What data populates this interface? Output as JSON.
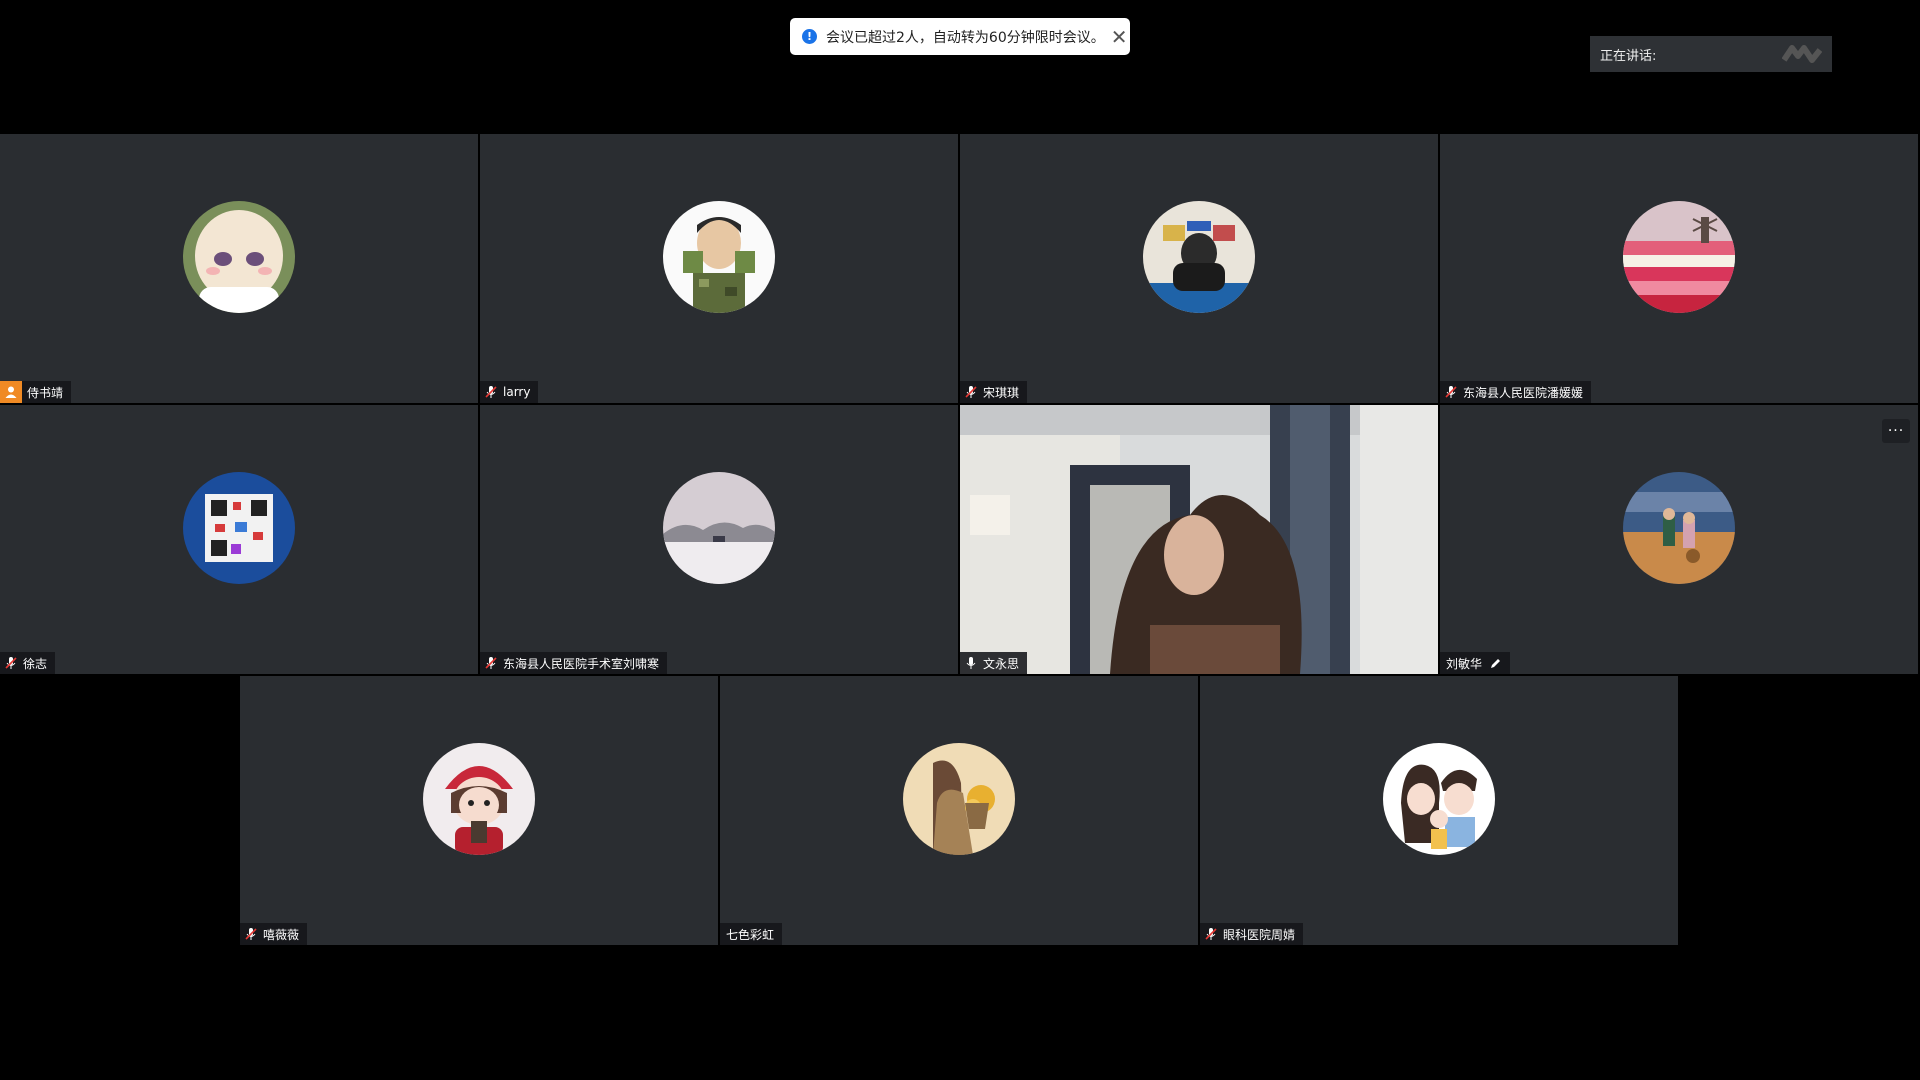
{
  "notification": {
    "message": "会议已超过2人，自动转为60分钟限时会议。",
    "close_glyph": "✕"
  },
  "speaking": {
    "label": "正在讲话:"
  },
  "participants": [
    {
      "name": "侍书靖",
      "icon": "user-host-icon"
    },
    {
      "name": "larry",
      "icon": "mic-muted-icon"
    },
    {
      "name": "宋琪琪",
      "icon": "mic-muted-icon"
    },
    {
      "name": "东海县人民医院潘媛媛",
      "icon": "mic-muted-icon"
    },
    {
      "name": "徐志",
      "icon": "mic-muted-icon"
    },
    {
      "name": "东海县人民医院手术室刘啸寒",
      "icon": "mic-muted-icon"
    },
    {
      "name": "文永思",
      "icon": "mic-icon"
    },
    {
      "name": "刘敏华",
      "icon": "edit-icon"
    },
    {
      "name": "嘻薇薇",
      "icon": "mic-muted-icon"
    },
    {
      "name": "七色彩虹",
      "icon": "none"
    },
    {
      "name": "眼科医院周婧",
      "icon": "mic-muted-icon"
    }
  ],
  "more_button": "···",
  "colors": {
    "tile": "#2a2d31",
    "background": "#000000",
    "accent": "#1a73e8",
    "host_badge": "#f08a24"
  }
}
